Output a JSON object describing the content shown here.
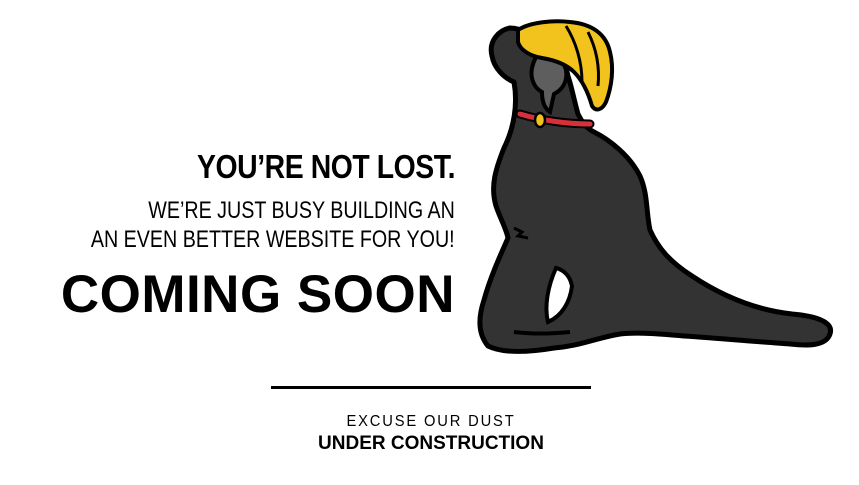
{
  "message": {
    "not_lost": "YOU’RE NOT LOST.",
    "building_line1": "WE’RE  JUST BUSY BUILDING AN",
    "building_line2": "AN EVEN BETTER WEBSITE FOR YOU!",
    "coming_soon": "COMING SOON"
  },
  "footer": {
    "excuse": "EXCUSE OUR DUST",
    "under_construction": "UNDER CONSTRUCTION"
  },
  "illustration": {
    "subject": "black-dog-with-yellow-hard-hat",
    "colors": {
      "dog_body": "#333333",
      "dog_outline": "#000000",
      "snout": "#5e5e5e",
      "hat": "#f2c31c",
      "collar": "#d8303a",
      "tag": "#f2c31c"
    }
  }
}
